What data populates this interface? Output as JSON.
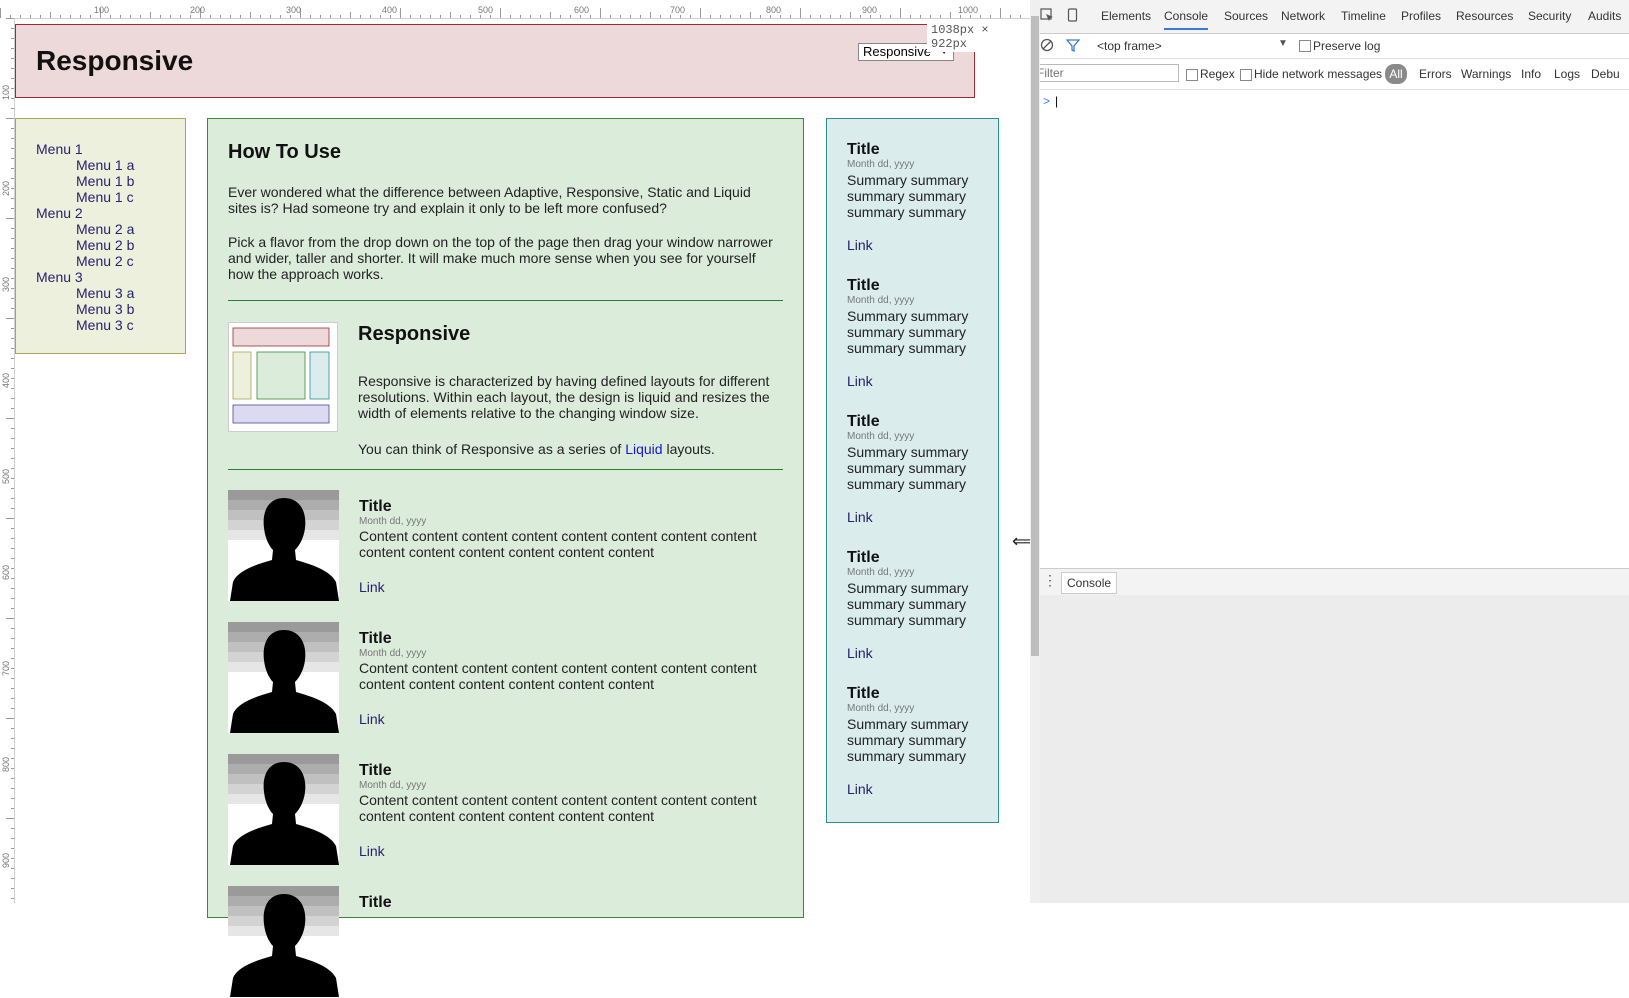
{
  "ruler": {
    "top_labels": [
      "100",
      "200",
      "300",
      "400",
      "500",
      "600",
      "700",
      "800",
      "900",
      "1000"
    ],
    "left_labels": [
      "100",
      "200",
      "300",
      "400",
      "500",
      "600",
      "700",
      "800",
      "900"
    ]
  },
  "viewport_dims": "1038px × 922px",
  "header": {
    "title": "Responsive",
    "flavor_select": "Responsive"
  },
  "menu": {
    "items": [
      {
        "label": "Menu 1",
        "subs": [
          "Menu 1 a",
          "Menu 1 b",
          "Menu 1 c"
        ]
      },
      {
        "label": "Menu 2",
        "subs": [
          "Menu 2 a",
          "Menu 2 b",
          "Menu 2 c"
        ]
      },
      {
        "label": "Menu 3",
        "subs": [
          "Menu 3 a",
          "Menu 3 b",
          "Menu 3 c"
        ]
      }
    ]
  },
  "main": {
    "title": "How To Use",
    "p1": "Ever wondered what the difference between Adaptive, Responsive, Static and Liquid sites is? Had someone try and explain it only to be left more confused?",
    "p2": "Pick a flavor from the drop down on the top of the page then drag your window narrower and wider, taller and shorter. It will make much more sense when you see for yourself how the approach works.",
    "resp_title": "Responsive",
    "resp_desc": "Responsive is characterized by having defined layouts for different resolutions. Within each layout, the design is liquid and resizes the width of elements relative to the changing window size.",
    "resp_desc2_pre": "You can think of Responsive as a series of ",
    "resp_desc2_link": "Liquid",
    "resp_desc2_post": " layouts.",
    "articles": [
      {
        "title": "Title",
        "date": "Month dd, yyyy",
        "body": "Content content content content content content content content content content content content content content",
        "link": "Link"
      },
      {
        "title": "Title",
        "date": "Month dd, yyyy",
        "body": "Content content content content content content content content content content content content content content",
        "link": "Link"
      },
      {
        "title": "Title",
        "date": "Month dd, yyyy",
        "body": "Content content content content content content content content content content content content content content",
        "link": "Link"
      },
      {
        "title": "Title",
        "date": "",
        "body": "",
        "link": ""
      }
    ]
  },
  "sidebar": {
    "items": [
      {
        "title": "Title",
        "date": "Month dd, yyyy",
        "summary": "Summary summary summary summary summary summary",
        "link": "Link"
      },
      {
        "title": "Title",
        "date": "Month dd, yyyy",
        "summary": "Summary summary summary summary summary summary",
        "link": "Link"
      },
      {
        "title": "Title",
        "date": "Month dd, yyyy",
        "summary": "Summary summary summary summary summary summary",
        "link": "Link"
      },
      {
        "title": "Title",
        "date": "Month dd, yyyy",
        "summary": "Summary summary summary summary summary summary",
        "link": "Link"
      },
      {
        "title": "Title",
        "date": "Month dd, yyyy",
        "summary": "Summary summary summary summary summary summary",
        "link": "Link"
      }
    ]
  },
  "devtools": {
    "tabs": [
      "Elements",
      "Console",
      "Sources",
      "Network",
      "Timeline",
      "Profiles",
      "Resources",
      "Security",
      "Audits"
    ],
    "active_tab": "Console",
    "frame": "<top frame>",
    "preserve_log": "Preserve log",
    "filter_placeholder": "Filter",
    "regex": "Regex",
    "hide_network": "Hide network messages",
    "levels": [
      "All",
      "Errors",
      "Warnings",
      "Info",
      "Logs",
      "Debu"
    ],
    "prompt": ">",
    "drawer_tab": "Console"
  },
  "colors": {
    "header_bg": "#edd9da",
    "menu_bg": "#eef0de",
    "main_bg": "#dcecdb",
    "sidebar_bg": "#dbecec",
    "link": "#26226e",
    "accent": "#3879d9"
  }
}
